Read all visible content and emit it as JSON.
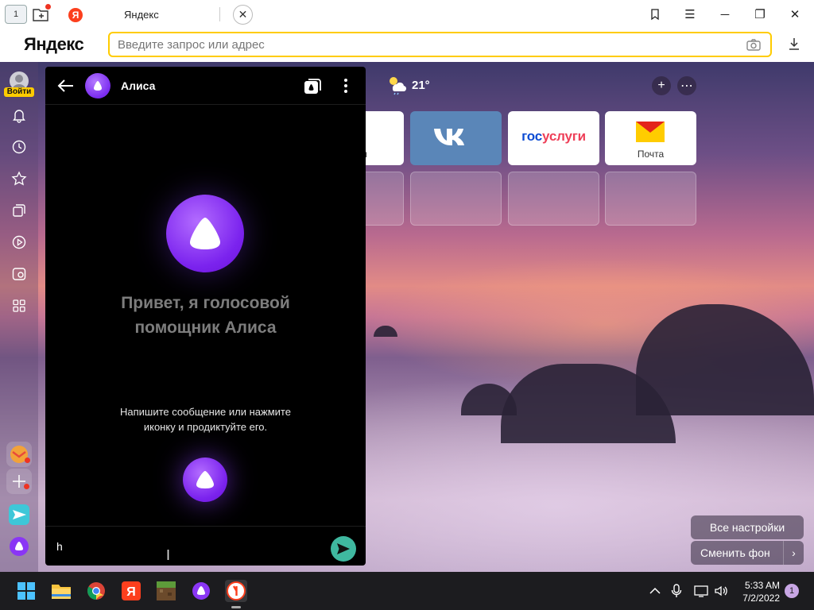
{
  "browser": {
    "tab_home_count": "1",
    "tab_title": "Яндекс",
    "tab_favicon_letter": "Я",
    "logo": "Яндекс",
    "omnibox_placeholder": "Введите запрос или адрес"
  },
  "sidebar": {
    "login_label": "Войти",
    "items": [
      {
        "icon": "bell-icon"
      },
      {
        "icon": "history-icon"
      },
      {
        "icon": "star-icon"
      },
      {
        "icon": "collections-icon"
      },
      {
        "icon": "play-icon"
      },
      {
        "icon": "screenshot-icon"
      },
      {
        "icon": "apps-grid-icon"
      }
    ]
  },
  "alice": {
    "title": "Алиса",
    "greeting_line1": "Привет, я голосовой",
    "greeting_line2": "помощник Алиса",
    "hint_line1": "Напишите сообщение или нажмите",
    "hint_line2": "иконку и продиктуйте его.",
    "input_value": "h"
  },
  "newtab": {
    "weather_temp": "21°",
    "tiles": [
      {
        "label": "ы"
      },
      {
        "label": "VK"
      },
      {
        "label": "госуслуги"
      },
      {
        "label": "Почта"
      }
    ],
    "all_settings": "Все настройки",
    "change_background": "Сменить фон"
  },
  "taskbar": {
    "time": "5:33 AM",
    "date": "7/2/2022",
    "notifications": "1"
  },
  "colors": {
    "accent_yellow": "#ffcc00",
    "yandex_red": "#fc3f1d",
    "alice_purple": "#7b23ee",
    "send_teal": "#3fb8a0"
  }
}
